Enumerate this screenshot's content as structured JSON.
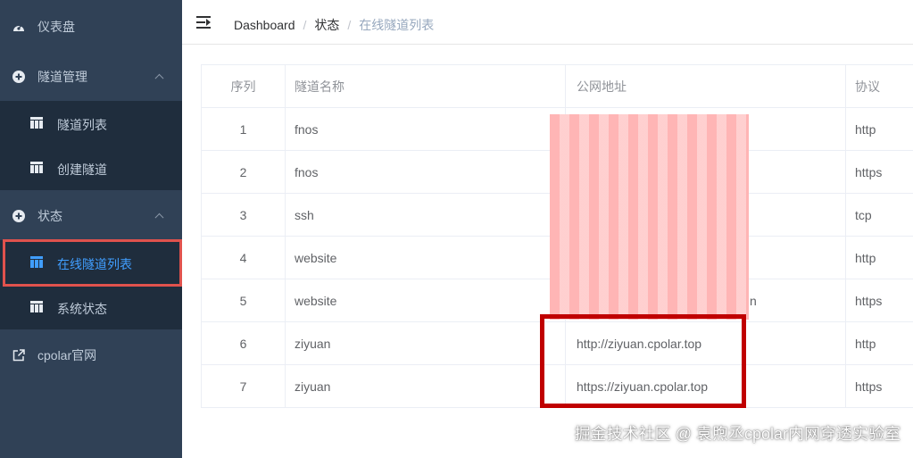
{
  "sidebar": {
    "dashboard": {
      "label": "仪表盘",
      "icon": "dashboard-icon"
    },
    "tunnel_mgmt": {
      "label": "隧道管理",
      "icon": "plus-circle-icon",
      "children": [
        {
          "label": "隧道列表",
          "icon": "table-icon"
        },
        {
          "label": "创建隧道",
          "icon": "table-icon"
        }
      ]
    },
    "status": {
      "label": "状态",
      "icon": "plus-circle-icon",
      "children": [
        {
          "label": "在线隧道列表",
          "icon": "table-icon",
          "active": true
        },
        {
          "label": "系统状态",
          "icon": "table-icon"
        }
      ]
    },
    "website": {
      "label": "cpolar官网",
      "icon": "external-link-icon"
    }
  },
  "header": {
    "breadcrumb": [
      "Dashboard",
      "状态",
      "在线隧道列表"
    ],
    "separator": "/"
  },
  "table": {
    "columns": [
      "序列",
      "隧道名称",
      "公网地址",
      "协议"
    ],
    "rows": [
      {
        "idx": "1",
        "name": "fnos",
        "url": "",
        "protocol": "http"
      },
      {
        "idx": "2",
        "name": "fnos",
        "url": "",
        "protocol": "https"
      },
      {
        "idx": "3",
        "name": "ssh",
        "url": "",
        "protocol": "tcp"
      },
      {
        "idx": "4",
        "name": "website",
        "url": "",
        "protocol": "http"
      },
      {
        "idx": "5",
        "name": "website",
        "url": "",
        "protocol": "https"
      },
      {
        "idx": "6",
        "name": "ziyuan",
        "url": "http://ziyuan.cpolar.top",
        "protocol": "http"
      },
      {
        "idx": "7",
        "name": "ziyuan",
        "url": "https://ziyuan.cpolar.top",
        "protocol": "https"
      }
    ],
    "redacted_tail": "n"
  },
  "watermark": "掘金技术社区 @ 袁煦丞cpolar内网穿透实验室",
  "colors": {
    "sidebar_bg": "#304156",
    "submenu_bg": "#1f2d3d",
    "active_text": "#409eff",
    "highlight_red": "#c00000",
    "active_outline": "#e0524d"
  }
}
